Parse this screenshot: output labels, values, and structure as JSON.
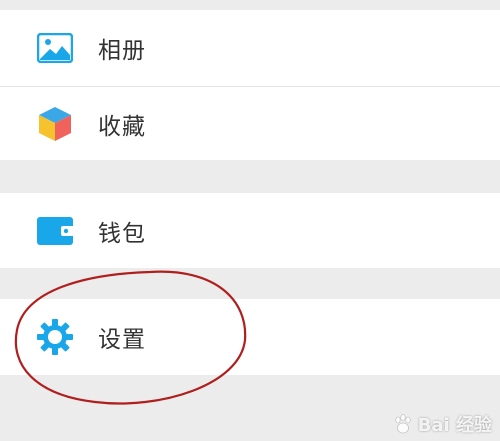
{
  "menu": {
    "items": [
      {
        "id": "album",
        "label": "相册",
        "icon": "album-icon"
      },
      {
        "id": "collection",
        "label": "收藏",
        "icon": "cube-icon"
      },
      {
        "id": "wallet",
        "label": "钱包",
        "icon": "wallet-icon"
      },
      {
        "id": "settings",
        "label": "设置",
        "icon": "gear-icon"
      }
    ]
  },
  "annotation": {
    "color": "#b01e1e",
    "target": "settings"
  },
  "watermark": {
    "text": "Bai 经验",
    "icon": "baidu-paw-icon"
  },
  "colors": {
    "accent": "#1aa7ea",
    "background": "#ececec",
    "row": "#ffffff",
    "text": "#333333"
  }
}
